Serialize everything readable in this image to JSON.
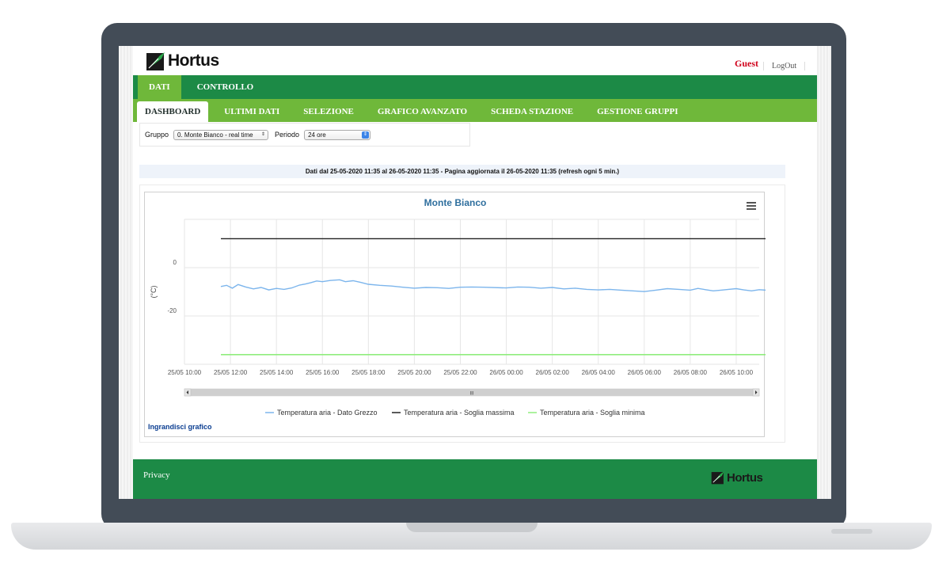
{
  "app": {
    "logo_text": "Hortus"
  },
  "user": {
    "guest_label": "Guest",
    "logout_label": "LogOut"
  },
  "nav_main": {
    "tabs": [
      {
        "label": "DATI"
      },
      {
        "label": "CONTROLLO"
      }
    ]
  },
  "nav_sub": {
    "tabs": [
      {
        "label": "DASHBOARD"
      },
      {
        "label": "ULTIMI DATI"
      },
      {
        "label": "SELEZIONE"
      },
      {
        "label": "GRAFICO AVANZATO"
      },
      {
        "label": "SCHEDA STAZIONE"
      },
      {
        "label": "GESTIONE GRUPPI"
      }
    ]
  },
  "filters": {
    "group_label": "Gruppo",
    "group_value": "0. Monte Bianco - real time",
    "period_label": "Periodo",
    "period_value": "24 ore"
  },
  "info": {
    "text": "Dati dal 25-05-2020 11:35 al 26-05-2020 11:35    -    Pagina aggiornata il 26-05-2020 11:35 (refresh ogni 5 min.)"
  },
  "chart": {
    "enlarge_label": "Ingrandisci grafico",
    "scrollbar_grip": "III",
    "colors": {
      "raw": "#7cb5ec",
      "max": "#222222",
      "min": "#90ed7d"
    }
  },
  "chart_data": {
    "type": "line",
    "title": "Monte Bianco",
    "ylabel": "(°C)",
    "xlabel": "",
    "ylim": [
      -40,
      20
    ],
    "yticks": [
      0,
      -20
    ],
    "x_range": [
      "25/05 10:00",
      "26/05 11:00"
    ],
    "x_ticks": [
      "25/05 10:00",
      "25/05 12:00",
      "25/05 14:00",
      "25/05 16:00",
      "25/05 18:00",
      "25/05 20:00",
      "25/05 22:00",
      "26/05 00:00",
      "26/05 02:00",
      "26/05 04:00",
      "26/05 06:00",
      "26/05 08:00",
      "26/05 10:00"
    ],
    "series": [
      {
        "name": "Temperatura aria - Dato Grezzo",
        "x": [
          "25/05 11:35",
          "25/05 11:50",
          "25/05 12:05",
          "25/05 12:20",
          "25/05 12:40",
          "25/05 13:00",
          "25/05 13:20",
          "25/05 13:40",
          "25/05 14:00",
          "25/05 14:20",
          "25/05 14:40",
          "25/05 15:00",
          "25/05 15:15",
          "25/05 15:30",
          "25/05 15:45",
          "25/05 16:00",
          "25/05 16:20",
          "25/05 16:45",
          "25/05 17:00",
          "25/05 17:20",
          "25/05 17:40",
          "25/05 18:00",
          "25/05 18:30",
          "25/05 19:00",
          "25/05 19:30",
          "25/05 20:00",
          "25/05 20:30",
          "25/05 21:00",
          "25/05 21:30",
          "25/05 22:00",
          "25/05 22:30",
          "25/05 23:00",
          "26/05 00:00",
          "26/05 00:30",
          "26/05 01:00",
          "26/05 01:30",
          "26/05 02:00",
          "26/05 02:30",
          "26/05 03:00",
          "26/05 03:30",
          "26/05 04:00",
          "26/05 04:30",
          "26/05 05:00",
          "26/05 05:30",
          "26/05 06:00",
          "26/05 06:30",
          "26/05 07:00",
          "26/05 07:30",
          "26/05 08:00",
          "26/05 08:20",
          "26/05 08:40",
          "26/05 09:00",
          "26/05 09:20",
          "26/05 09:40",
          "26/05 10:00",
          "26/05 10:20",
          "26/05 10:40",
          "26/05 11:00",
          "26/05 11:35"
        ],
        "values": [
          -7.8,
          -7.3,
          -8.5,
          -7.0,
          -8.0,
          -8.8,
          -8.2,
          -9.2,
          -8.6,
          -9.0,
          -8.4,
          -7.2,
          -6.8,
          -6.2,
          -5.5,
          -5.8,
          -5.3,
          -5.0,
          -5.8,
          -5.4,
          -6.1,
          -6.9,
          -7.3,
          -7.6,
          -8.1,
          -8.5,
          -8.2,
          -8.3,
          -8.6,
          -8.1,
          -8.0,
          -8.1,
          -8.4,
          -8.0,
          -8.1,
          -8.5,
          -8.2,
          -8.8,
          -8.5,
          -9.0,
          -9.2,
          -9.0,
          -9.3,
          -9.6,
          -9.9,
          -9.3,
          -8.7,
          -9.0,
          -9.3,
          -8.6,
          -9.1,
          -9.6,
          -9.3,
          -9.0,
          -8.7,
          -9.2,
          -9.6,
          -9.1,
          -9.5
        ]
      },
      {
        "name": "Temperatura aria - Soglia massima",
        "x": [
          "25/05 11:35",
          "26/05 11:35"
        ],
        "values": [
          12,
          12
        ]
      },
      {
        "name": "Temperatura aria - Soglia minima",
        "x": [
          "25/05 11:35",
          "26/05 11:35"
        ],
        "values": [
          -36,
          -36
        ]
      }
    ]
  },
  "footer": {
    "privacy_label": "Privacy",
    "logo_text": "Hortus"
  }
}
